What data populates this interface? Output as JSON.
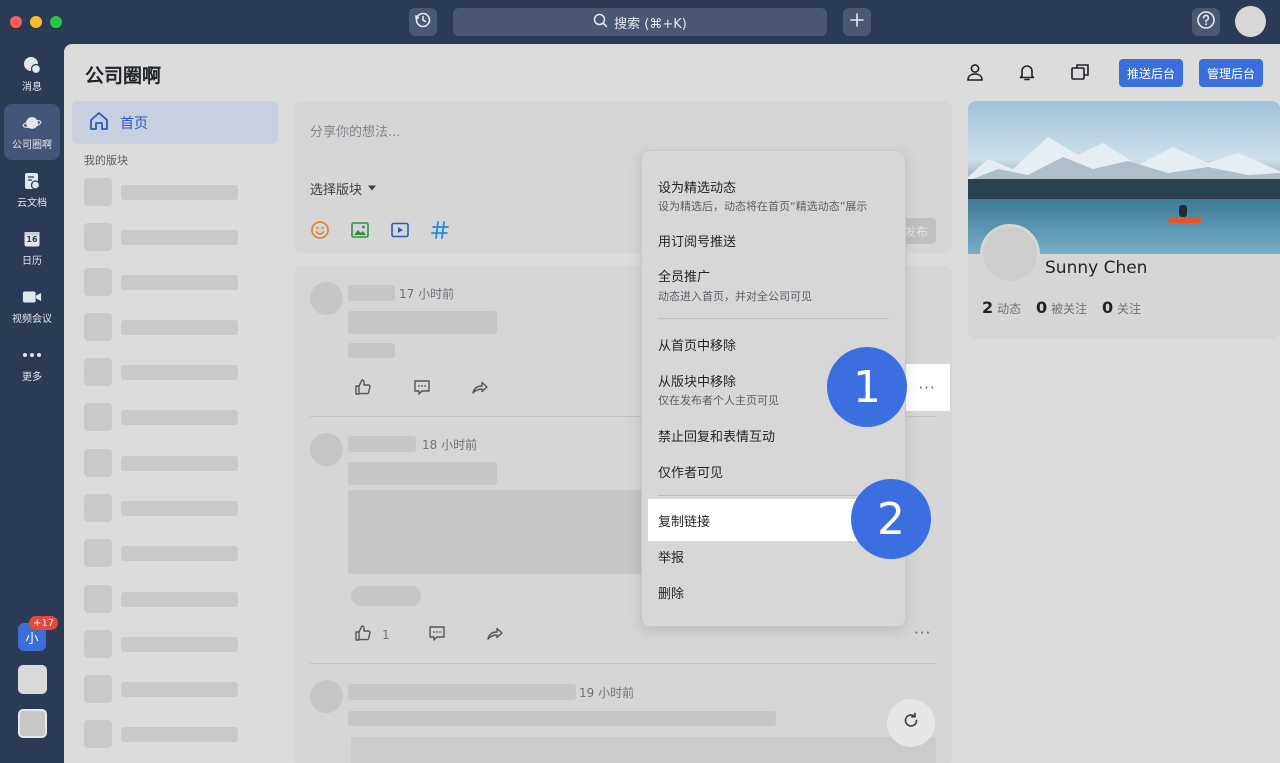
{
  "titlebar": {
    "search_label": "搜索 (⌘+K)",
    "history_icon": "history-icon",
    "add_icon": "plus-icon",
    "help_icon": "help-icon"
  },
  "rail": {
    "items": [
      {
        "label": "消息",
        "icon": "message-icon"
      },
      {
        "label": "公司圈啊",
        "icon": "planet-icon"
      },
      {
        "label": "云文档",
        "icon": "document-icon"
      },
      {
        "label": "日历",
        "icon": "calendar-icon",
        "date": "16"
      },
      {
        "label": "视频会议",
        "icon": "video-icon"
      },
      {
        "label": "更多",
        "icon": "more-icon"
      }
    ],
    "assistant_label": "小",
    "assistant_badge": "+17"
  },
  "header": {
    "title": "公司圈啊",
    "push_button": "推送后台",
    "admin_button": "管理后台"
  },
  "sidebar": {
    "home_label": "首页",
    "my_blocks_label": "我的版块"
  },
  "composer": {
    "placeholder": "分享你的想法...",
    "block_select": "选择版块",
    "publish": "发布"
  },
  "feed": {
    "posts": [
      {
        "time": "17 小时前"
      },
      {
        "time": "18 小时前",
        "likes": "1"
      },
      {
        "time": "19 小时前"
      }
    ]
  },
  "profile": {
    "name": "Sunny Chen",
    "posts_count": "2",
    "posts_label": "动态",
    "followers_count": "0",
    "followers_label": "被关注",
    "following_count": "0",
    "following_label": "关注"
  },
  "menu": {
    "items": [
      {
        "label": "设为精选动态",
        "sub": "设为精选后，动态将在首页“精选动态”展示"
      },
      {
        "label": "用订阅号推送"
      },
      {
        "label": "全员推广",
        "sub": "动态进入首页，并对全公司可见"
      },
      {
        "label": "从首页中移除"
      },
      {
        "label": "从版块中移除",
        "sub": "仅在发布者个人主页可见"
      },
      {
        "label": "禁止回复和表情互动"
      },
      {
        "label": "仅作者可见"
      },
      {
        "label": "复制链接"
      },
      {
        "label": "举报"
      },
      {
        "label": "删除"
      }
    ]
  },
  "annotations": {
    "step1": "1",
    "step2": "2"
  },
  "colors": {
    "accent": "#3a6fd9",
    "rail_bg": "#2b3a55",
    "annotation": "#3b6fe0"
  }
}
